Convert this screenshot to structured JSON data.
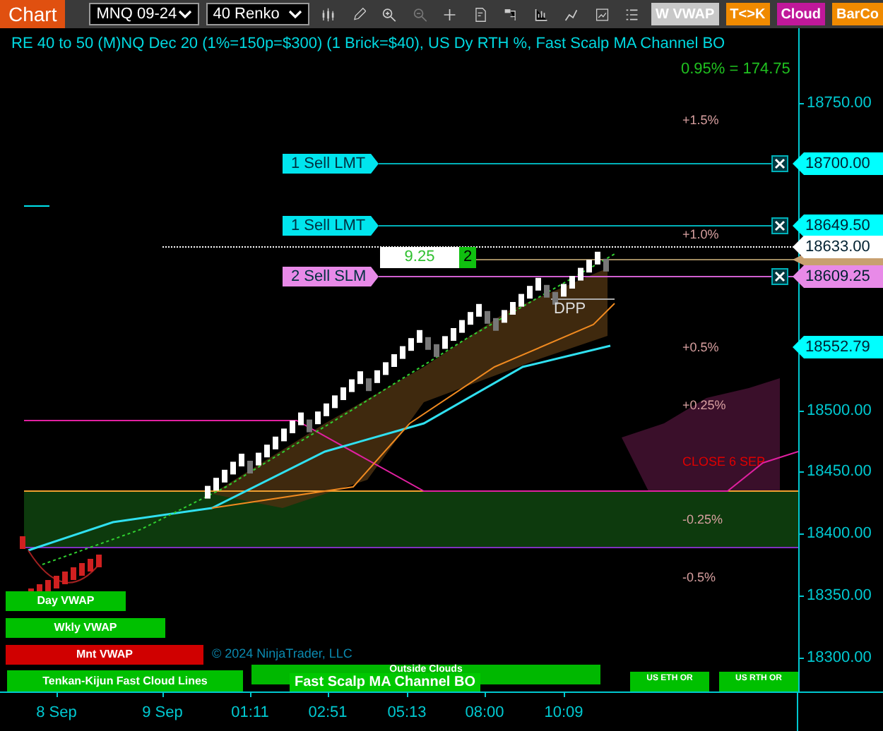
{
  "toolbar": {
    "tab": "Chart",
    "instrument": "MNQ 09-24",
    "bar_type": "40 Renko",
    "buttons": [
      {
        "label": "W VWAP",
        "color": "#c8c8c8"
      },
      {
        "label": "T<>K",
        "color": "#f08a00"
      },
      {
        "label": "Cloud",
        "color": "#c0189a"
      },
      {
        "label": "BarCo",
        "color": "#f08a00"
      }
    ]
  },
  "chart": {
    "title": "RE 40 to 50 (M)NQ Dec 20 (1%=150p=$300) (1 Brick=$40), US Dy RTH %, Fast Scalp MA Channel BO",
    "range_readout": "0.95% = 174.75",
    "orders": [
      {
        "label": "1 Sell LMT",
        "color": "#00e5ee"
      },
      {
        "label": "1 Sell LMT",
        "color": "#00e5ee"
      },
      {
        "label": "2 Sell SLM",
        "color": "#e88ae8"
      }
    ],
    "position": {
      "pnl": "9.25",
      "quantity": "2"
    },
    "drawing_label": "DPP",
    "percent_levels": [
      {
        "label": "+1.5%",
        "color": "#d8a0a0"
      },
      {
        "label": "+1.0%",
        "color": "#d8a0a0"
      },
      {
        "label": "+0.5%",
        "color": "#d8a0a0"
      },
      {
        "label": "+0.25%",
        "color": "#d8a0a0"
      },
      {
        "label": "CLOSE 6 SEP",
        "color": "#e00000"
      },
      {
        "label": "-0.25%",
        "color": "#d8a0a0"
      },
      {
        "label": "-0.5%",
        "color": "#d8a0a0"
      }
    ],
    "vwap_badges": [
      {
        "label": "Day VWAP",
        "color": "#00c000"
      },
      {
        "label": "Wkly VWAP",
        "color": "#00c000"
      },
      {
        "label": "Mnt VWAP",
        "color": "#d00000"
      }
    ],
    "copyright": "© 2024 NinjaTrader, LLC",
    "indicator_badges": [
      {
        "label": "Tenkan-Kijun Fast Cloud Lines",
        "kind": "wide"
      },
      {
        "label": "Outside Clouds",
        "kind": "back"
      },
      {
        "label": "Fast Scalp MA Channel BO",
        "kind": "front"
      },
      {
        "label": "US ETH OR",
        "kind": "small"
      },
      {
        "label": "US RTH OR",
        "kind": "small"
      }
    ]
  },
  "price_axis": {
    "ticks": [
      "18750.00",
      "18500.00",
      "18450.00",
      "18400.00",
      "18350.00",
      "18300.00"
    ],
    "flags": [
      {
        "label": "18700.00",
        "color": "#00ffff"
      },
      {
        "label": "18649.50",
        "color": "#00ffff"
      },
      {
        "label": "18633.00",
        "color": "#ffffff"
      },
      {
        "label": "18609.25",
        "color": "#e88ae8"
      },
      {
        "label": "18552.79",
        "color": "#00ffff"
      }
    ]
  },
  "time_axis": {
    "labels": [
      "8 Sep",
      "9 Sep",
      "01:11",
      "02:51",
      "05:13",
      "08:00",
      "10:09"
    ]
  }
}
